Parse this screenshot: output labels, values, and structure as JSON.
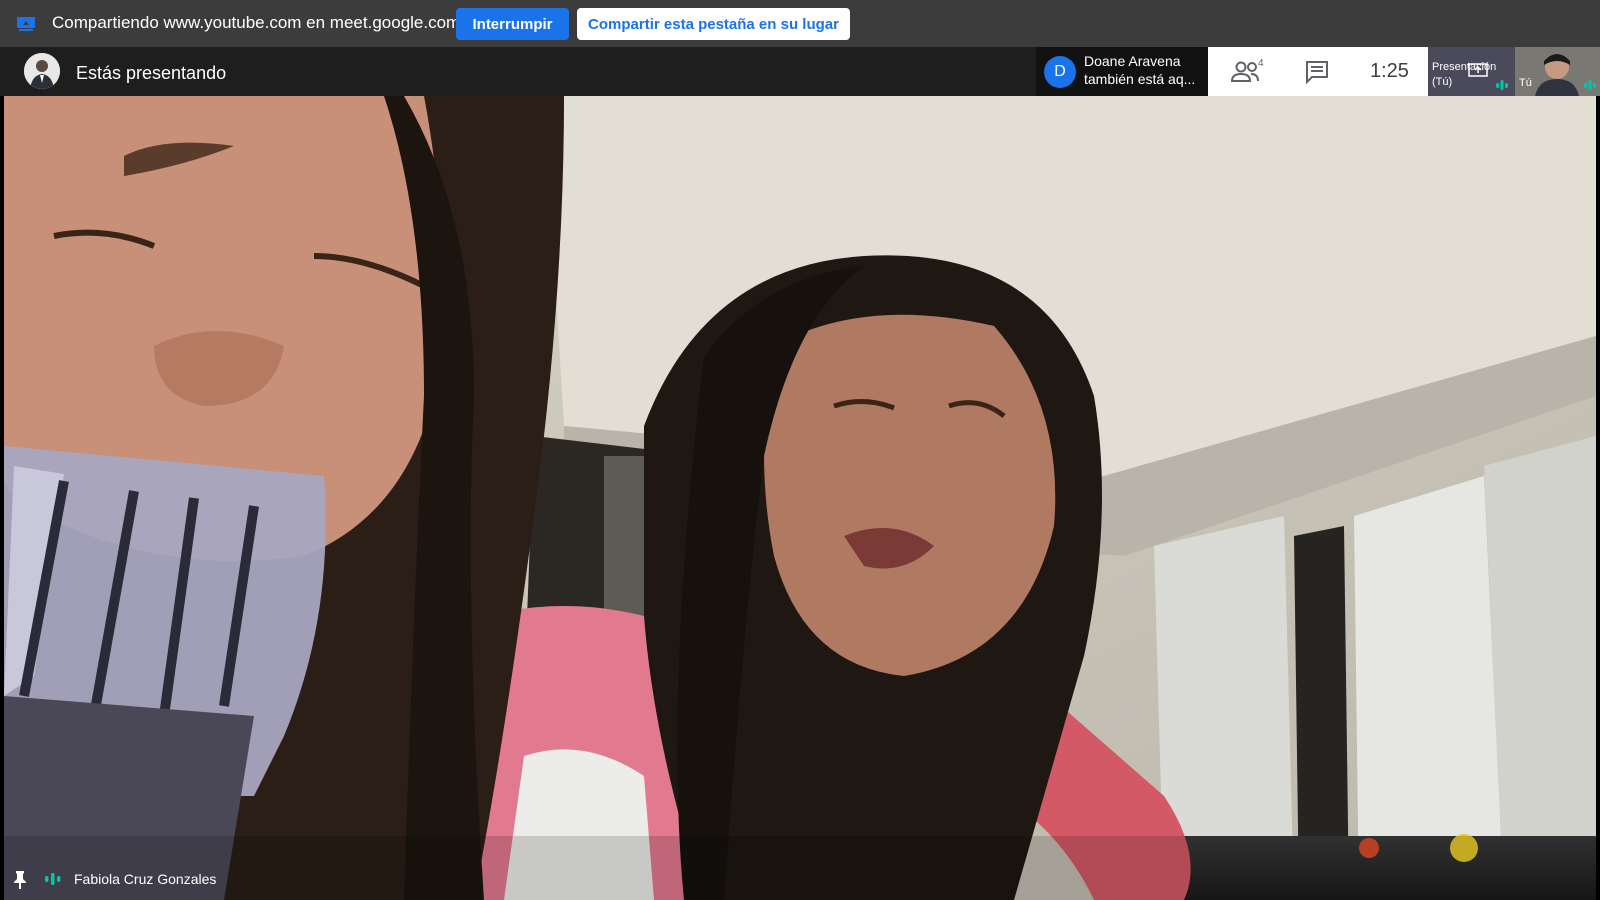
{
  "share_bar": {
    "text": "Compartiendo www.youtube.com en meet.google.com",
    "stop_label": "Interrumpir",
    "share_tab_label": "Compartir esta pestaña en su lugar",
    "icon": "screen-share-icon"
  },
  "header": {
    "presenting_text": "Estás presentando",
    "notification": {
      "avatar_letter": "D",
      "name": "Doane Aravena",
      "message": "también está aq..."
    },
    "controls": {
      "people_count": "4",
      "time": "1:25"
    },
    "thumbnails": {
      "presentation_label_1": "Presentación",
      "presentation_label_2": "(Tú)",
      "you_label": "Tú"
    }
  },
  "video": {
    "participant_name": "Fabiola Cruz Gonzales"
  },
  "colors": {
    "accent": "#1a73e8",
    "share_bar_bg": "#3c3c3c",
    "header_bg": "#1e1e1e",
    "audio_indicator": "#00c7a8"
  }
}
